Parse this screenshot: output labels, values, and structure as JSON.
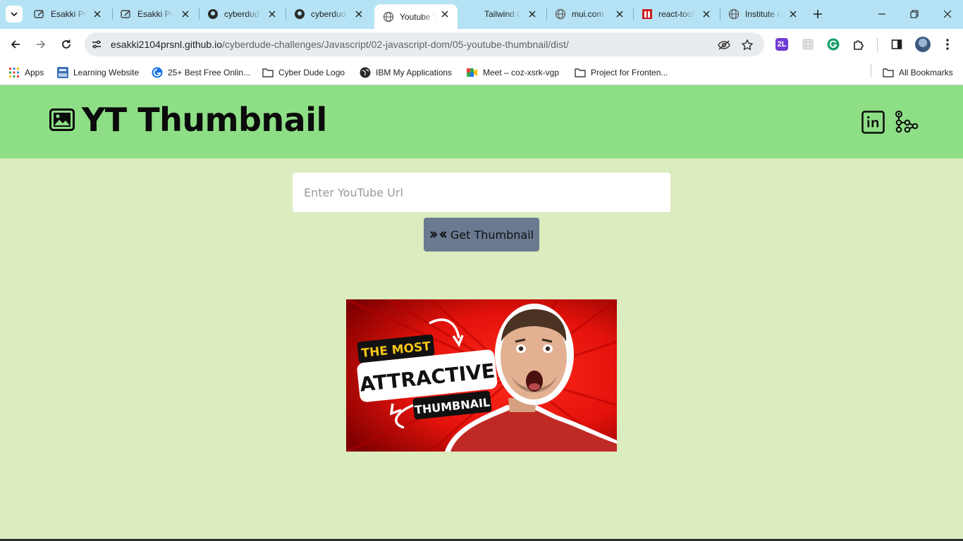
{
  "browser": {
    "tabs": [
      {
        "title": "Esakki Portfolio",
        "icon": "pen-icon",
        "active": false
      },
      {
        "title": "Esakki Portfolio",
        "icon": "pen-icon",
        "active": false
      },
      {
        "title": "cyberdude-challenges",
        "icon": "github-icon",
        "active": false
      },
      {
        "title": "cyberdude-challenges",
        "icon": "github-icon",
        "active": false
      },
      {
        "title": "Youtube Thumbnail",
        "icon": "globe-icon",
        "active": true
      },
      {
        "title": "Tailwind CSS",
        "icon": "tailwind-icon",
        "active": false
      },
      {
        "title": "mui.com",
        "icon": "globe-icon",
        "active": false
      },
      {
        "title": "react-toolkit",
        "icon": "npm-icon",
        "active": false
      },
      {
        "title": "Institute of",
        "icon": "globe-icon",
        "active": false
      }
    ],
    "url_host": "esakki2104prsnl.github.io",
    "url_path": "/cyberdude-challenges/Javascript/02-javascript-dom/05-youtube-thumbnail/dist/",
    "extension_badge": "2L",
    "bookmarks": [
      {
        "label": "Apps",
        "icon": "apps-grid-icon"
      },
      {
        "label": "Learning Website",
        "icon": "css-grid-icon"
      },
      {
        "label": "25+ Best Free Onlin...",
        "icon": "blue-globe-icon"
      },
      {
        "label": "Cyber Dude Logo",
        "icon": "folder-icon"
      },
      {
        "label": "IBM My Applications",
        "icon": "globe-dark-icon"
      },
      {
        "label": "Meet – coz-xsrk-vgp",
        "icon": "meet-icon"
      },
      {
        "label": "Project for Fronten...",
        "icon": "folder-icon"
      }
    ],
    "all_bookmarks_label": "All Bookmarks"
  },
  "site": {
    "title": "YT Thumbnail",
    "linkedin_icon": "linkedin-icon",
    "git_icon": "git-branch-icon"
  },
  "form": {
    "placeholder": "Enter YouTube Url",
    "button_label": "Get Thumbnail"
  },
  "thumbnail": {
    "line1": "THE MOST",
    "line2": "ATTRACTIVE",
    "line3": "THUMBNAIL",
    "colors": {
      "bg": "#e3120b",
      "accent": "#f5c518"
    }
  }
}
